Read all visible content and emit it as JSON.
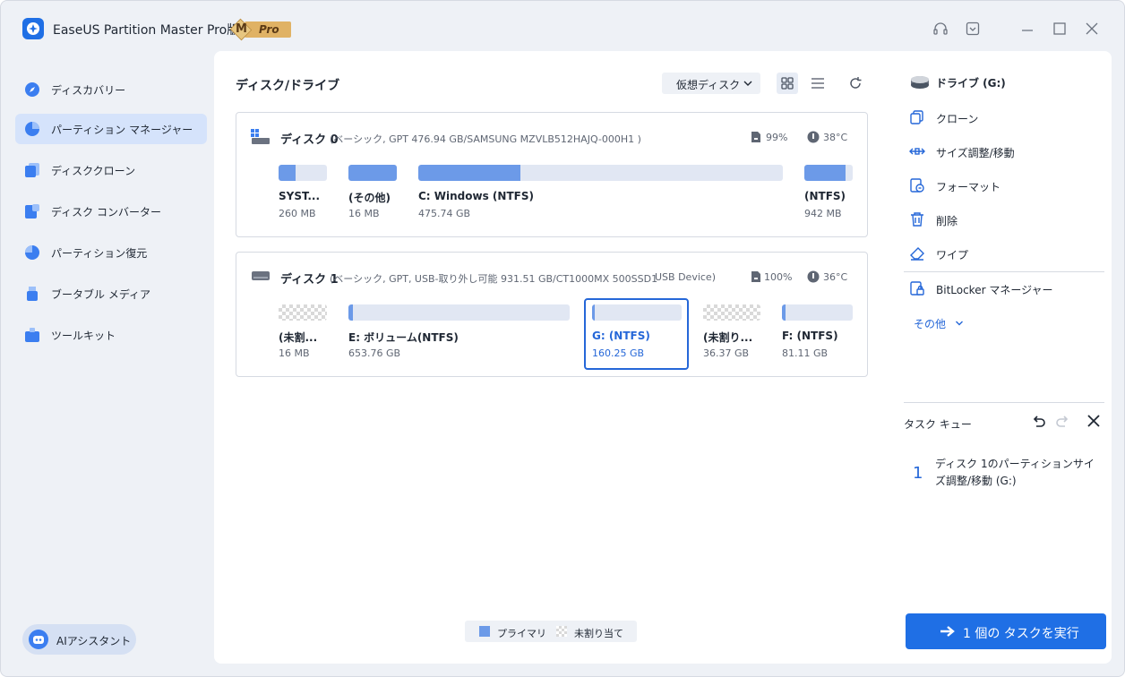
{
  "app": {
    "title": "EaseUS Partition Master Pro版",
    "badge_m": "M",
    "badge_pro": "Pro"
  },
  "sidebar": {
    "items": [
      {
        "label": "ディスカバリー",
        "icon": "compass-icon"
      },
      {
        "label": "パーティション マネージャー",
        "icon": "pie-chart-icon",
        "active": true
      },
      {
        "label": "ディスククローン",
        "icon": "disk-clone-icon"
      },
      {
        "label": "ディスク コンバーター",
        "icon": "disk-convert-icon"
      },
      {
        "label": "パーティション復元",
        "icon": "partition-recovery-icon"
      },
      {
        "label": "ブータブル メディア",
        "icon": "usb-drive-icon"
      },
      {
        "label": "ツールキット",
        "icon": "toolkit-icon"
      }
    ],
    "ai_assistant": "AIアシスタント"
  },
  "main": {
    "title": "ディスク/ドライブ",
    "virtual_disk": "仮想ディスク",
    "disks": [
      {
        "name": "ディスク 0",
        "desc": "(ベーシック, GPT 476.94 GB/SAMSUNG MZVLB512HAJQ-000H1 )",
        "health": "99%",
        "temp": "38°C",
        "partitions": [
          {
            "name": "SYST...",
            "size": "260 MB",
            "used": 0.35
          },
          {
            "name": "(その他)",
            "size": "16 MB",
            "used": 1.0
          },
          {
            "name": "C: Windows (NTFS)",
            "size": "475.74 GB",
            "used": 0.28
          },
          {
            "name": "(NTFS)",
            "size": "942 MB",
            "used": 0.85
          }
        ]
      },
      {
        "name": "ディスク 1",
        "desc": "(ベーシック, GPT, USB-取り外し可能 931.51 GB/CT1000MX 500SSD1",
        "usb": "USB Device)",
        "health": "100%",
        "temp": "36°C",
        "partitions": [
          {
            "name": "(未割...",
            "size": "16 MB",
            "unallocated": true
          },
          {
            "name": "E: ボリューム(NTFS)",
            "size": "653.76 GB",
            "used": 0.02
          },
          {
            "name": "G: (NTFS)",
            "size": "160.25 GB",
            "used": 0.03,
            "selected": true
          },
          {
            "name": "(未割り...",
            "size": "36.37 GB",
            "unallocated": true
          },
          {
            "name": "F: (NTFS)",
            "size": "81.11 GB",
            "used": 0.05
          }
        ]
      }
    ],
    "legend": {
      "primary": "プライマリ",
      "unallocated": "未割り当て"
    }
  },
  "right_panel": {
    "drive": "ドライブ (G:)",
    "actions": [
      {
        "label": "クローン",
        "icon": "clone-icon"
      },
      {
        "label": "サイズ調整/移動",
        "icon": "resize-move-icon"
      },
      {
        "label": "フォーマット",
        "icon": "format-icon"
      },
      {
        "label": "削除",
        "icon": "trash-icon"
      },
      {
        "label": "ワイプ",
        "icon": "eraser-icon"
      },
      {
        "label": "BitLocker マネージャー",
        "icon": "bitlocker-icon"
      }
    ],
    "more": "その他",
    "task_queue": {
      "title": "タスク キュー",
      "tasks": [
        {
          "num": "1",
          "text": "ディスク 1のパーティションサイズ調整/移動 (G:)"
        }
      ]
    },
    "run_button": "1 個の タスクを実行"
  },
  "colors": {
    "accent": "#1f6fe5",
    "partition_fill": "#6c9ae8",
    "bar_bg": "#e1e7f3"
  }
}
